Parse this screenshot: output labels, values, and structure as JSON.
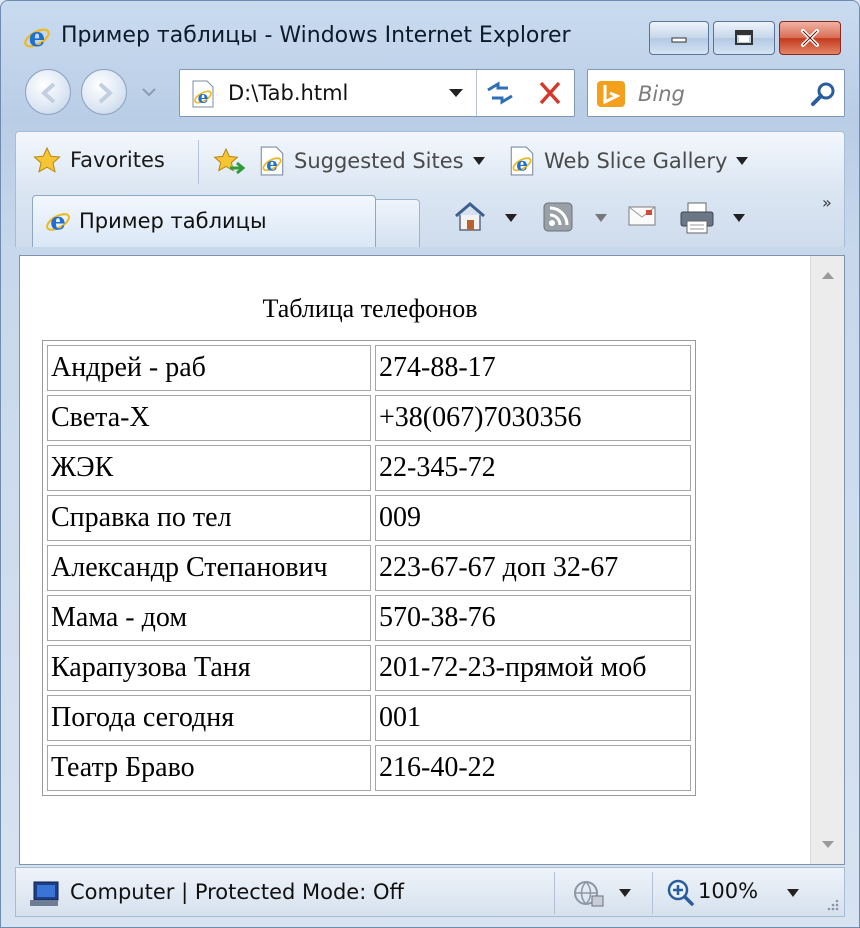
{
  "window": {
    "title": "Пример таблицы - Windows Internet Explorer"
  },
  "navigation": {
    "address": "D:\\Tab.html",
    "search_placeholder": "Bing"
  },
  "favorites_bar": {
    "favorites_label": "Favorites",
    "items": [
      {
        "label": "Suggested Sites",
        "icon": "ie-page-icon"
      },
      {
        "label": "Web Slice Gallery",
        "icon": "ie-page-icon"
      }
    ]
  },
  "tabs": {
    "active_label": "Пример таблицы"
  },
  "page": {
    "caption": "Таблица телефонов",
    "rows": [
      {
        "name": "Андрей - раб",
        "phone": "274-88-17"
      },
      {
        "name": "Света-Х",
        "phone": "+38(067)7030356"
      },
      {
        "name": "ЖЭК",
        "phone": "22-345-72"
      },
      {
        "name": "Справка по тел",
        "phone": "009"
      },
      {
        "name": "Александр Степанович",
        "phone": "223-67-67 доп 32-67"
      },
      {
        "name": "Мама - дом",
        "phone": "570-38-76"
      },
      {
        "name": "Карапузова Таня",
        "phone": "201-72-23-прямой моб"
      },
      {
        "name": "Погода сегодня",
        "phone": "001"
      },
      {
        "name": "Театр Браво",
        "phone": "216-40-22"
      }
    ]
  },
  "statusbar": {
    "zone": "Computer | Protected Mode: Off",
    "zoom": "100%"
  },
  "colors": {
    "ie_blue": "#1f6fd1",
    "ie_gold": "#f0b81c",
    "close_red": "#c4391d",
    "bing_orange": "#f3a11c"
  }
}
